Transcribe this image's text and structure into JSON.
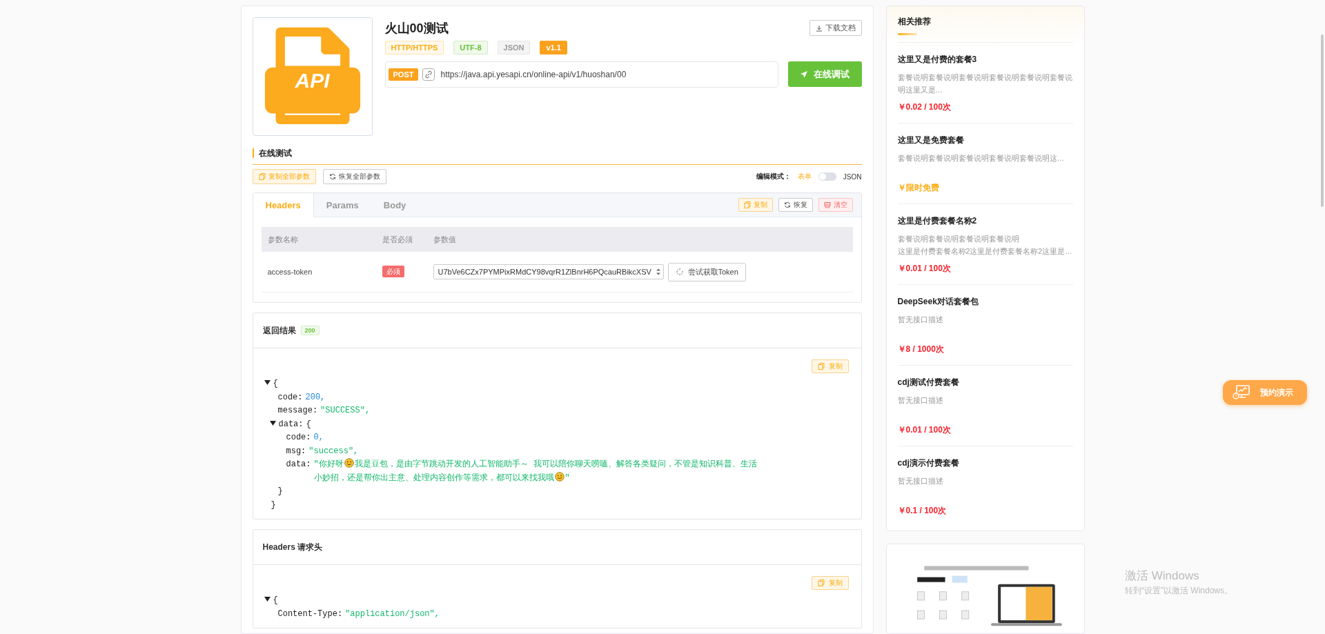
{
  "api": {
    "logo_text": "API",
    "title": "火山00测试",
    "download_button": "下载文档",
    "tags": [
      {
        "label": "HTTP/HTTPS",
        "kind": "protocol"
      },
      {
        "label": "UTF-8",
        "kind": "charset"
      },
      {
        "label": "JSON",
        "kind": "format"
      },
      {
        "label": "v1.1",
        "kind": "version"
      }
    ],
    "method": "POST",
    "url": "https://java.api.yesapi.cn/online-api/v1/huoshan/00",
    "test_button": "在线调试"
  },
  "online_test": {
    "heading": "在线测试",
    "copy_all_button": "复制全部参数",
    "restore_all_button": "恢复全部参数",
    "mode_label": "编辑模式：",
    "modes": [
      {
        "label": "表单",
        "selected": true
      },
      {
        "label": "JSON",
        "selected": false
      }
    ],
    "tabs": [
      {
        "label": "Headers",
        "selected": true
      },
      {
        "label": "Params",
        "selected": false
      },
      {
        "label": "Body",
        "selected": false
      }
    ],
    "actions": [
      {
        "label": "复制",
        "kind": "copy"
      },
      {
        "label": "恢复",
        "kind": "restore"
      },
      {
        "label": "清空",
        "kind": "clear"
      }
    ],
    "columns": [
      "参数名称",
      "是否必须",
      "参数值"
    ],
    "rows": [
      {
        "name": "access-token",
        "required": "必须",
        "value": "U7bVe6CZx7PYMPixRMdCY98vqrR1ZlBnrH6PQcauRBikcXSV",
        "button": "尝试获取Token"
      }
    ]
  },
  "result": {
    "title": "返回结果",
    "status": "200",
    "copy_button": "复制",
    "body": {
      "value": "{",
      "expanded": true,
      "close": "}",
      "children": [
        {
          "key": "code:",
          "value": "200",
          "comma": ",",
          "kind": "number"
        },
        {
          "key": "message:",
          "value": "\"SUCCESS\"",
          "comma": ",",
          "kind": "string"
        },
        {
          "key": "data:",
          "value": "{",
          "kind": "object",
          "expanded": true,
          "close": "}",
          "children": [
            {
              "key": "code:",
              "value": "0",
              "comma": ",",
              "kind": "number"
            },
            {
              "key": "msg:",
              "value": "\"success\"",
              "comma": ",",
              "kind": "string"
            },
            {
              "key": "data:",
              "kind": "emoji_string",
              "segments": [
                {
                  "kind": "text",
                  "text": "\"你好呀"
                },
                {
                  "kind": "smiley"
                },
                {
                  "kind": "text",
                  "text": " 我是豆包，是由字节跳动开发的人工智能助手～ 我可以陪你聊天唠嗑、解答各类疑问，不管是知识科普、生活"
                },
                {
                  "kind": "break"
                },
                {
                  "kind": "text",
                  "text": "小妙招，还是帮你出主意、处理内容创作等需求，都可以来找我哦"
                },
                {
                  "kind": "wink"
                },
                {
                  "kind": "text",
                  "text": "\""
                }
              ]
            }
          ]
        }
      ]
    }
  },
  "headers": {
    "title": "Headers 请求头",
    "copy_button": "复制",
    "open": "{",
    "expanded": true,
    "lines": [
      {
        "key": "Content-Type:",
        "value": "\"application/json\"",
        "comma": ","
      }
    ]
  },
  "sidebar": {
    "title": "相关推荐",
    "items": [
      {
        "name": "这里又是付费的套餐3",
        "description": [
          "套餐说明套餐说明套餐说明套餐说明套餐说明套餐说明这里又是…"
        ],
        "price": "￥0.02 / 100次",
        "color": "#f5222d"
      },
      {
        "name": "这里又是免费套餐",
        "description": [
          "套餐说明套餐说明套餐说明套餐说明套餐说明这…"
        ],
        "price": "￥限时免费",
        "color": "#faad14"
      },
      {
        "name": "这里是付费套餐名称2",
        "description": [
          "套餐说明套餐说明套餐说明套餐说明",
          "这里是付费套餐名称2这里是付费套餐名称2这里是…"
        ],
        "price": "￥0.01 / 100次",
        "color": "#f5222d"
      },
      {
        "name": "DeepSeek对话套餐包",
        "description": [
          "暂无接口描述"
        ],
        "price": "￥8 / 1000次",
        "color": "#f5222d"
      },
      {
        "name": "cdj测试付费套餐",
        "description": [
          "暂无接口描述"
        ],
        "price": "￥0.01 / 100次",
        "color": "#f5222d"
      },
      {
        "name": "cdj演示付费套餐",
        "description": [
          "暂无接口描述"
        ],
        "price": "￥0.1 / 100次",
        "color": "#f5222d"
      }
    ]
  },
  "demo_button": "预约演示",
  "os_watermark": {
    "title": "激活 Windows",
    "subtitle": "转到“设置”以激活 Windows。"
  }
}
